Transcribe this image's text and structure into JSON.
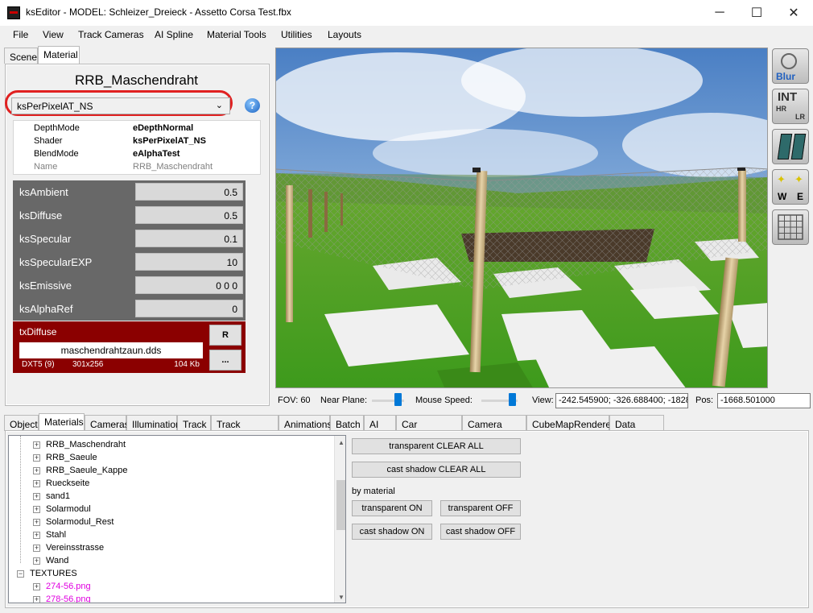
{
  "window": {
    "title": "ksEditor - MODEL: Schleizer_Dreieck - Assetto Corsa Test.fbx",
    "minimize_glyph": "─",
    "maximize_glyph": "☐",
    "close_glyph": "✕"
  },
  "menu": [
    "File",
    "View",
    "Track Cameras",
    "AI Spline",
    "Material Tools",
    "Utilities",
    "Layouts"
  ],
  "left_tabs": [
    "Scene",
    "Material"
  ],
  "material": {
    "name": "RRB_Maschendraht",
    "shader_selected": "ksPerPixelAT_NS",
    "help_glyph": "?",
    "properties": [
      {
        "key": "DepthMode",
        "value": "eDepthNormal"
      },
      {
        "key": "Shader",
        "value": "ksPerPixelAT_NS"
      },
      {
        "key": "BlendMode",
        "value": "eAlphaTest"
      },
      {
        "key": "Name",
        "value": "RRB_Maschendraht"
      }
    ],
    "params": [
      {
        "label": "ksAmbient",
        "value": "0.5"
      },
      {
        "label": "ksDiffuse",
        "value": "0.5"
      },
      {
        "label": "ksSpecular",
        "value": "0.1"
      },
      {
        "label": "ksSpecularEXP",
        "value": "10"
      },
      {
        "label": "ksEmissive",
        "value": "0 0 0"
      },
      {
        "label": "ksAlphaRef",
        "value": "0"
      }
    ],
    "texture": {
      "slot": "txDiffuse",
      "file": "maschendrahtzaun.dds",
      "format": "DXT5 (9)",
      "dimensions": "301x256",
      "size": "104 Kb",
      "reload_label": "R",
      "browse_label": "..."
    }
  },
  "side_icons": {
    "blur": "Blur",
    "int": "INT",
    "hr": "HR",
    "lr": "LR",
    "w": "W",
    "e": "E"
  },
  "toolbar": {
    "fov": "FOV: 60",
    "near_plane_label": "Near Plane:",
    "near_plane_level": 0.9,
    "mouse_speed_label": "Mouse Speed:",
    "mouse_speed_level": 0.95,
    "view_label": "View:",
    "view_value": "-242.545900; -326.688400; -1828",
    "pos_label": "Pos:",
    "pos_value": "-1668.501000"
  },
  "bottom_tabs": [
    "Object",
    "Materials",
    "Cameras",
    "Illumination",
    "Track",
    "Track Cameras",
    "Animations",
    "Batch",
    "AI",
    "Car Animations",
    "Camera Spline",
    "CubeMapRenderer",
    "Data Scripts"
  ],
  "tree": {
    "materials": [
      "RRB_Maschendraht",
      "RRB_Saeule",
      "RRB_Saeule_Kappe",
      "Rueckseite",
      "sand1",
      "Solarmodul",
      "Solarmodul_Rest",
      "Stahl",
      "Vereinsstrasse",
      "Wand"
    ],
    "textures_label": "TEXTURES",
    "textures": [
      "274-56.png",
      "278-56.png"
    ]
  },
  "actions": {
    "transparent_clear_all": "transparent CLEAR ALL",
    "cast_shadow_clear_all": "cast shadow CLEAR ALL",
    "by_material": "by material",
    "transparent_on": "transparent ON",
    "transparent_off": "transparent OFF",
    "cast_shadow_on": "cast shadow ON",
    "cast_shadow_off": "cast shadow OFF"
  },
  "colors": {
    "accent": "#0078d7",
    "texture_panel": "#8b0000",
    "param_row": "#686868",
    "highlight_ring": "#e02020",
    "texture_item": "#e000e0"
  }
}
